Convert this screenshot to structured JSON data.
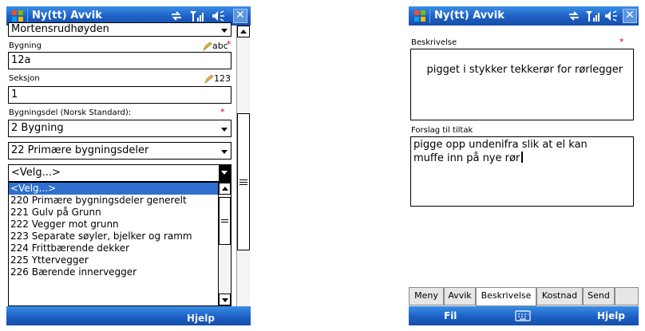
{
  "left": {
    "window_title": "Ny(tt) Avvik",
    "top_field_value": "Mortensrudhøyden",
    "bygning": {
      "label": "Bygning",
      "value": "12a",
      "input_hint": "abc",
      "required_mark": "*"
    },
    "seksjon": {
      "label": "Seksjon",
      "value": "1",
      "input_hint": "123"
    },
    "bygningsdel": {
      "label": "Bygningsdel (Norsk Standard):",
      "required_mark": "*",
      "level1": "2 Bygning",
      "level2": "22 Primære bygningsdeler",
      "level3": "<Velg...>"
    },
    "dropdown_options": [
      "<Velg...>",
      "220 Primære bygningsdeler generelt",
      "221 Gulv på Grunn",
      "222 Vegger mot grunn",
      "223 Separate søyler, bjelker og ramm",
      "224 Frittbærende dekker",
      "225 Yttervegger",
      "226 Bærende innervegger"
    ],
    "selected_option_index": 0,
    "softkey_right_partial": "Hjelp"
  },
  "right": {
    "window_title": "Ny(tt) Avvik",
    "beskrivelse": {
      "label": "Beskrivelse",
      "required_mark": "*",
      "value": "pigget i stykker tekkerør for rørlegger"
    },
    "forslag": {
      "label": "Forslag til tiltak",
      "value": "pigge opp undenifra slik at el kan\nmuffe inn på nye rør"
    },
    "tabs": [
      "Meny",
      "Avvik",
      "Beskrivelse",
      "Kostnad",
      "Send"
    ],
    "active_tab": "Beskrivelse",
    "softkey_left": "Fil",
    "softkey_right": "Hjelp"
  },
  "icons": {
    "windows-logo": "windows-flag-icon",
    "connectivity": "sync-arrows-icon",
    "signal": "signal-icon",
    "volume": "speaker-icon",
    "close": "close-icon",
    "keyboard": "keyboard-icon",
    "pencil": "pencil-icon"
  },
  "colors": {
    "titlebar": "#1d5fc4",
    "selection": "#2f6fcf",
    "required": "#d00000"
  }
}
